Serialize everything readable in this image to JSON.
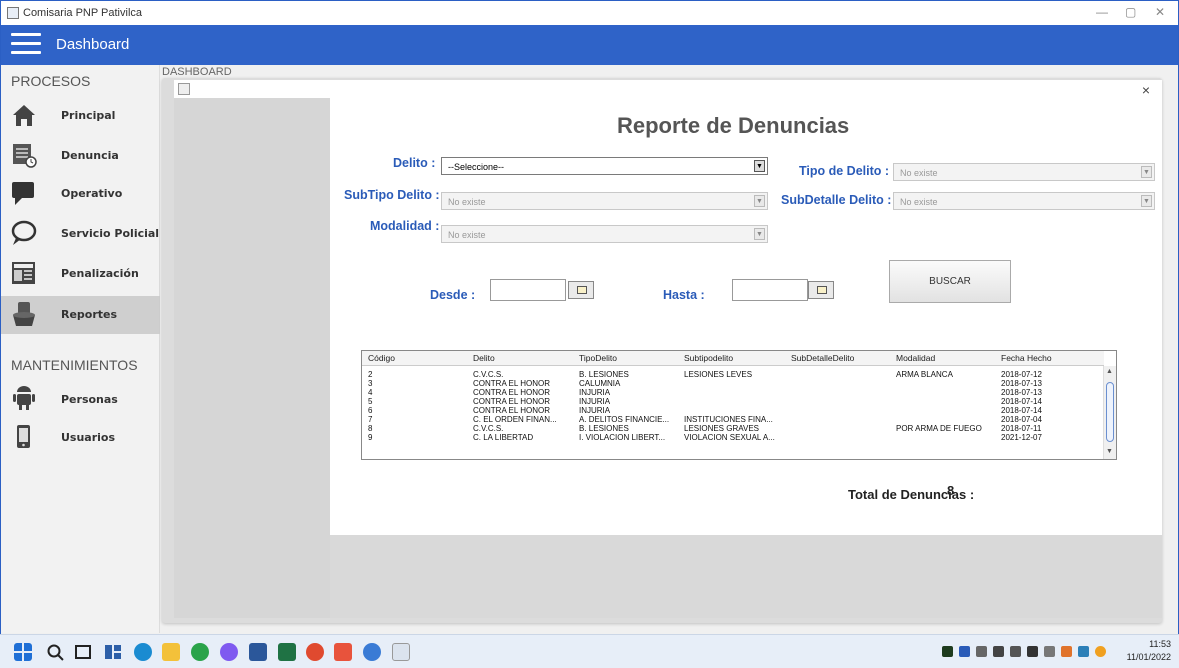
{
  "window": {
    "title": "Comisaria PNP Pativilca",
    "controls": [
      "—",
      "▢",
      "✕"
    ]
  },
  "topbar": {
    "title": "Dashboard"
  },
  "sidebar": {
    "section1": "PROCESOS",
    "items": [
      {
        "label": "Principal",
        "icon": "home-icon"
      },
      {
        "label": "Denuncia",
        "icon": "document-clock-icon"
      },
      {
        "label": "Operativo",
        "icon": "chat-icon"
      },
      {
        "label": "Servicio Policial",
        "icon": "speech-bubble-icon"
      },
      {
        "label": "Penalización",
        "icon": "newspaper-icon"
      },
      {
        "label": "Reportes",
        "icon": "inbox-icon"
      }
    ],
    "section2": "MANTENIMIENTOS",
    "items2": [
      {
        "label": "Personas",
        "icon": "android-icon"
      },
      {
        "label": "Usuarios",
        "icon": "device-icon"
      }
    ]
  },
  "main": {
    "dash_label": "DASHBOARD",
    "internal_close": "×",
    "report_title": "Reporte de Denuncias",
    "labels": {
      "delito": "Delito :",
      "tipo_delito": "Tipo de Delito :",
      "subtipo_delito": "SubTipo Delito :",
      "subdetalle_delito": "SubDetalle Delito :",
      "modalidad": "Modalidad :",
      "desde": "Desde :",
      "hasta": "Hasta :"
    },
    "combos": {
      "delito": "--Seleccione--",
      "tipo_delito": "No existe",
      "subtipo_delito": "No existe",
      "subdetalle_delito": "No existe",
      "modalidad": "No existe"
    },
    "buscar": "BUSCAR",
    "table": {
      "columns": [
        "Código",
        "Delito",
        "TipoDelito",
        "Subtipodelito",
        "SubDetalleDelito",
        "Modalidad",
        "Fecha Hecho"
      ],
      "rows": [
        [
          "2",
          "C.V.C.S.",
          "B. LESIONES",
          "LESIONES LEVES",
          "",
          "ARMA BLANCA",
          "2018-07-12"
        ],
        [
          "3",
          "CONTRA EL HONOR",
          "CALUMNIA",
          "",
          "",
          "",
          "2018-07-13"
        ],
        [
          "4",
          "CONTRA EL HONOR",
          "INJURIA",
          "",
          "",
          "",
          "2018-07-13"
        ],
        [
          "5",
          "CONTRA EL HONOR",
          "INJURIA",
          "",
          "",
          "",
          "2018-07-14"
        ],
        [
          "6",
          "CONTRA EL HONOR",
          "INJURIA",
          "",
          "",
          "",
          "2018-07-14"
        ],
        [
          "7",
          "C. EL ORDEN FINAN...",
          "A. DELITOS FINANCIE...",
          "INSTITUCIONES FINA...",
          "",
          "",
          "2018-07-04"
        ],
        [
          "8",
          "C.V.C.S.",
          "B. LESIONES",
          "LESIONES GRAVES",
          "",
          "POR ARMA DE FUEGO",
          "2018-07-11"
        ],
        [
          "9",
          "C. LA LIBERTAD",
          "I. VIOLACION LIBERT...",
          "VIOLACION SEXUAL A...",
          "",
          "",
          "2021-12-07"
        ]
      ]
    },
    "total_label": "Total de Denuncias :",
    "total_value": "8"
  },
  "taskbar": {
    "time": "11:53",
    "date": "11/01/2022"
  }
}
